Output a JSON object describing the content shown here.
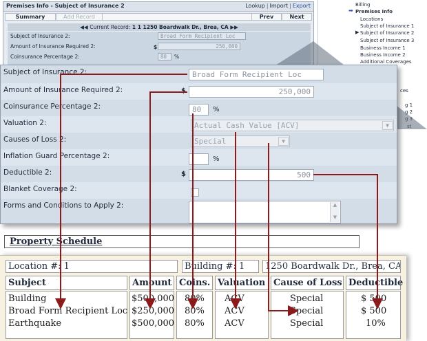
{
  "background_window": {
    "title": "Premises Info - Subject of Insurance 2",
    "links": [
      "Lookup",
      "Import",
      "Export"
    ],
    "tabs": {
      "summary": "Summary",
      "add_record": "Add Record",
      "prev": "Prev",
      "next": "Next"
    },
    "current_record_label": "Current Record:",
    "current_record_value": "1 1 1250 Boardwalk Dr., Brea, CA",
    "fields": {
      "subject_label": "Subject of Insurance 2:",
      "subject_value": "Broad Form Recipient Loc",
      "amount_label": "Amount of Insurance Required 2:",
      "amount_value": "250,000",
      "coins_label": "Coinsurance Percentage 2:",
      "coins_value": "80",
      "dollar": "$",
      "pct": "%"
    }
  },
  "nav": {
    "items": [
      {
        "label": "Billing",
        "bold": false,
        "current": false
      },
      {
        "label": "Premises Info",
        "bold": true,
        "current": false
      },
      {
        "label": "Locations",
        "bold": false,
        "current": false
      },
      {
        "label": "Subject of Insurance 1",
        "bold": false,
        "current": false
      },
      {
        "label": "Subject of Insurance 2",
        "bold": false,
        "current": true
      },
      {
        "label": "Subject of Insurance 3",
        "bold": false,
        "current": false
      },
      {
        "label": "Business Income 1",
        "bold": false,
        "current": false
      },
      {
        "label": "Business Income 2",
        "bold": false,
        "current": false
      },
      {
        "label": "Additional Coverages",
        "bold": false,
        "current": false
      }
    ],
    "partial": [
      "ces",
      "g 1",
      "g 2",
      "g 3",
      "st"
    ]
  },
  "form": {
    "subject": {
      "label": "Subject of Insurance 2:",
      "value": "Broad Form Recipient Loc"
    },
    "amount": {
      "label": "Amount of Insurance Required 2:",
      "prefix": "$",
      "value": "250,000"
    },
    "coinsurance": {
      "label": "Coinsurance Percentage 2:",
      "value": "80",
      "suffix": "%"
    },
    "valuation": {
      "label": "Valuation 2:",
      "value": "Actual Cash Value [ACV]"
    },
    "causes": {
      "label": "Causes of Loss 2:",
      "value": "Special"
    },
    "inflation": {
      "label": "Inflation Guard Percentage 2:",
      "value": "",
      "suffix": "%"
    },
    "deductible": {
      "label": "Deductible 2:",
      "prefix": "$",
      "value": "500"
    },
    "blanket": {
      "label": "Blanket Coverage 2:"
    },
    "forms": {
      "label": "Forms and Conditions to Apply 2:",
      "value": ""
    }
  },
  "schedule": {
    "title": "Property Schedule",
    "location": "Location #: 1",
    "building": "Building #: 1",
    "address": "1250 Boardwalk Dr., Brea, CA",
    "headers": [
      "Subject",
      "Amount",
      "Coins.",
      "Valuation",
      "Cause of Loss",
      "Deductible"
    ],
    "rows": [
      [
        "Building",
        "$500,000",
        "80%",
        "ACV",
        "Special",
        "$ 500"
      ],
      [
        "Broad Form Recipient Loc",
        "$250,000",
        "80%",
        "ACV",
        "Special",
        "$ 500"
      ],
      [
        "Earthquake",
        "$500,000",
        "80%",
        "ACV",
        "Special",
        "10%"
      ]
    ]
  },
  "colors": {
    "panel_bg": "#d3dde8",
    "schedule_bg": "#f6f1e0",
    "arrow": "#8b1a1a",
    "nav_arrow": "#2a4fa6"
  }
}
